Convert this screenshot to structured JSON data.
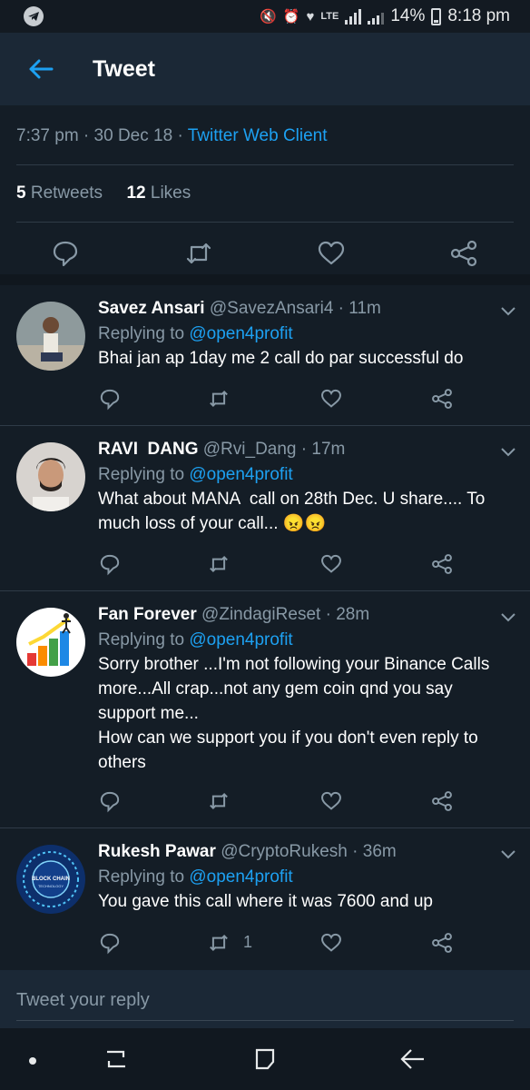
{
  "status_bar": {
    "battery": "14%",
    "time": "8:18 pm",
    "lte": "LTE",
    "icons": [
      "telegram-icon",
      "mute-icon",
      "alarm-icon",
      "heart-icon",
      "lte-icon",
      "signal-icon",
      "signal-icon",
      "battery-icon"
    ]
  },
  "header": {
    "title": "Tweet",
    "back_icon": "arrow-left-icon"
  },
  "tweet": {
    "time": "7:37 pm",
    "date": "30 Dec 18",
    "sep1": " · ",
    "sep2": " · ",
    "client": "Twitter Web Client",
    "retweets_count": "5",
    "retweets_label": "Retweets",
    "likes_count": "12",
    "likes_label": "Likes"
  },
  "colors": {
    "accent": "#1da1f2",
    "background": "#141d26",
    "muted": "#8899a6"
  },
  "replies": [
    {
      "name": "Savez Ansari",
      "handle": "@SavezAnsari4",
      "age": "11m",
      "replying_prefix": "Replying to",
      "replying_to": "@open4profit",
      "text": "Bhai jan ap 1day me 2 call do par successful do",
      "retweet_count": ""
    },
    {
      "name": "RAVI  DANG",
      "handle": "@Rvi_Dang",
      "age": "17m",
      "replying_prefix": "Replying to",
      "replying_to": "@open4profit",
      "text": "What about MANA  call on 28th Dec. U share.... To much loss of your call... 😠😠",
      "retweet_count": ""
    },
    {
      "name": "Fan Forever",
      "handle": "@ZindagiReset",
      "age": "28m",
      "replying_prefix": "Replying to",
      "replying_to": "@open4profit",
      "text": "Sorry brother ...I'm not following your Binance Calls more...All crap...not any gem coin qnd you say support me...\nHow can we support you if you don't even reply to others",
      "retweet_count": ""
    },
    {
      "name": "Rukesh Pawar",
      "handle": "@CryptoRukesh",
      "age": "36m",
      "replying_prefix": "Replying to",
      "replying_to": "@open4profit",
      "text": "You gave this call where it was 7600 and up",
      "retweet_count": "1"
    }
  ],
  "avatar_texts": {
    "blockchain": "BLOCK CHAIN",
    "technology": "TECHNOLOGY"
  },
  "compose": {
    "placeholder": "Tweet your reply"
  },
  "nav": {
    "icons": [
      "dot-icon",
      "recents-icon",
      "home-icon",
      "back-icon"
    ]
  }
}
